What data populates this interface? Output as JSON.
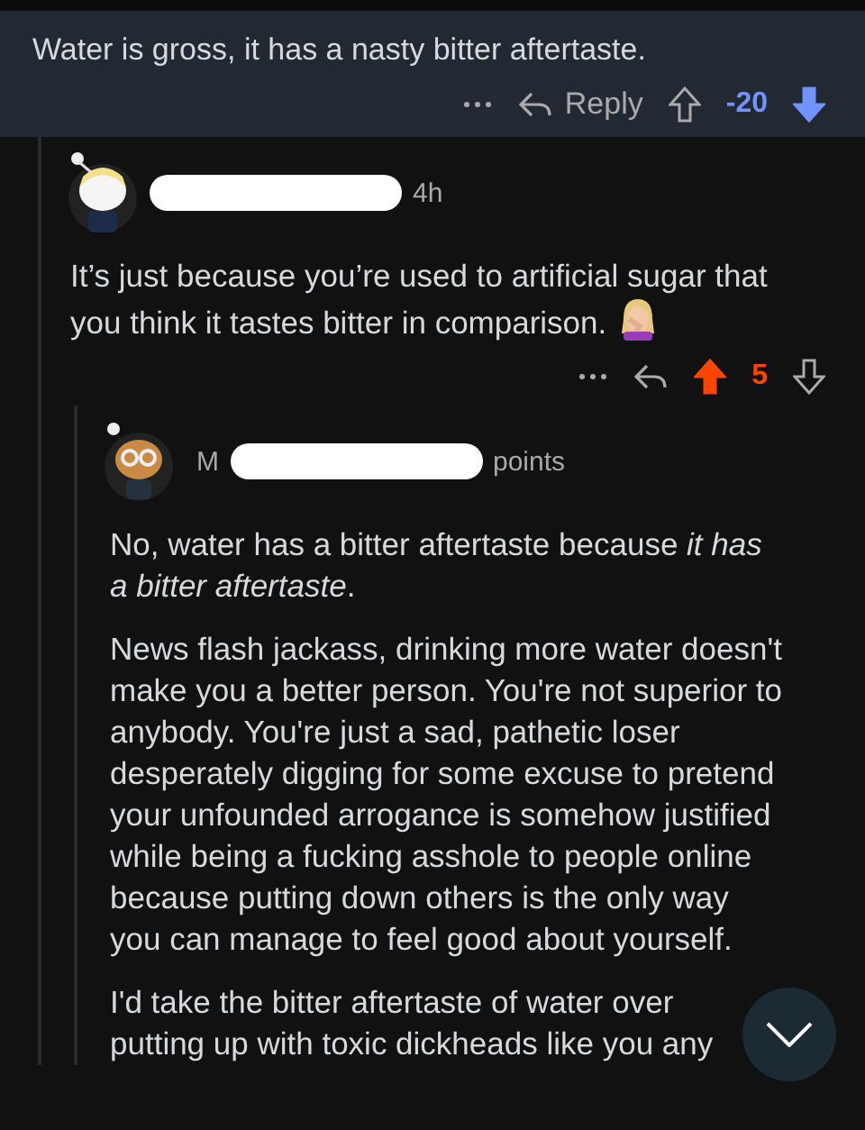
{
  "parent_comment": {
    "body": "Water is gross, it has a nasty bitter aftertaste.",
    "reply_label": "Reply",
    "score": "-20",
    "upvoted": false,
    "downvoted": true
  },
  "reply": {
    "time": "4h",
    "body": "It’s just because you’re used to artificial sugar that you think it tastes bitter in comparison.",
    "score": "5",
    "upvoted": true,
    "downvoted": false
  },
  "nested_reply": {
    "username": "M",
    "points_label": "points",
    "paragraphs": [
      "No, water has a bitter aftertaste because *it has a bitter aftertaste*.",
      "News flash jackass, drinking more water doesn't make you a better person. You're not superior to anybody. You're just a sad, pathetic loser desperately digging for some excuse to pretend your unfounded arrogance is somehow justified while being a fucking asshole to people online because putting down others is the only way you can manage to feel good about yourself.",
      "I'd take the bitter aftertaste of water over putting up with toxic dickheads like you any"
    ]
  }
}
